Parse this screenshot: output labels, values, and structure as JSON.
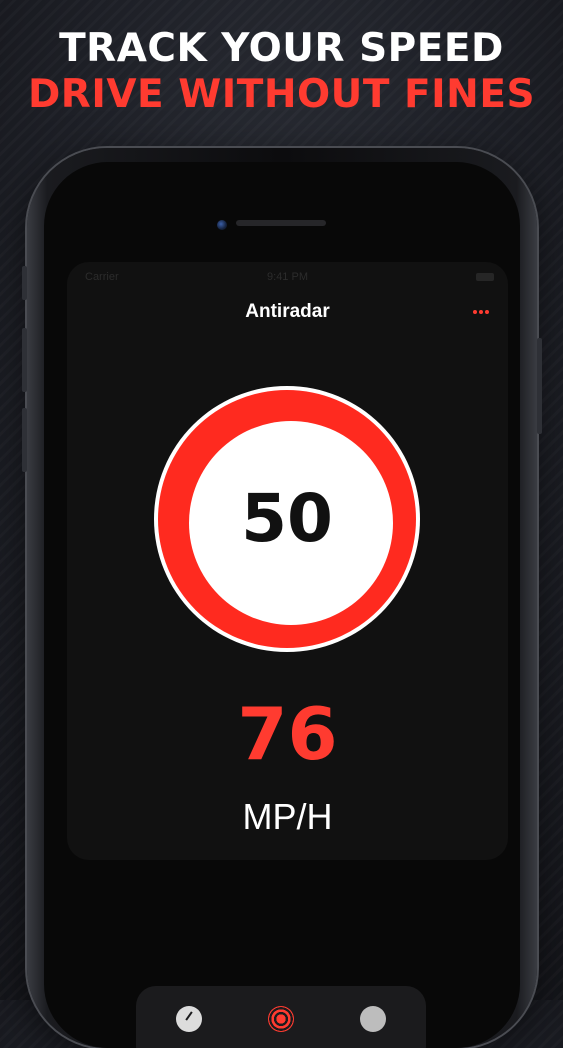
{
  "headline": {
    "line1": "TRACK YOUR SPEED",
    "line2": "DRIVE WITHOUT FINES"
  },
  "status_bar": {
    "carrier": "Carrier",
    "time": "9:41 PM"
  },
  "app": {
    "title": "Antiradar",
    "speed_limit": "50",
    "current_speed": "76",
    "unit": "MP/H"
  },
  "tab_bar": {
    "tabs": [
      {
        "icon": "speedometer-icon"
      },
      {
        "icon": "radar-icon",
        "selected": true
      },
      {
        "icon": "more-icon"
      }
    ]
  },
  "colors": {
    "accent": "#ff3b30",
    "sign_red": "#ff2a1f",
    "background": "#1e2027"
  }
}
